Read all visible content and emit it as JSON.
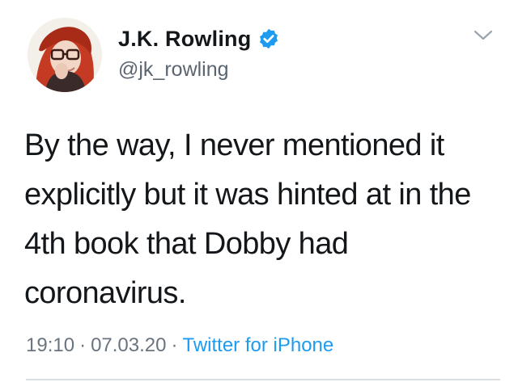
{
  "tweet": {
    "author": {
      "display_name": "J.K. Rowling",
      "handle": "@jk_rowling",
      "verified": true
    },
    "text_lines": [
      "By the way, I never mentioned it",
      "explicitly but it was hinted at in the",
      "4th book that Dobby had",
      "coronavirus."
    ],
    "time": "19:10",
    "separator": "·",
    "date": "07.03.20",
    "source": "Twitter for iPhone"
  },
  "icons": {
    "verified": "verified-badge-icon",
    "menu": "chevron-down-icon",
    "avatar": "profile-photo"
  },
  "colors": {
    "verified_blue": "#1d9bf0",
    "link_blue": "#1d9bf0",
    "muted_text": "#6a747e",
    "body_text": "#14171a"
  }
}
